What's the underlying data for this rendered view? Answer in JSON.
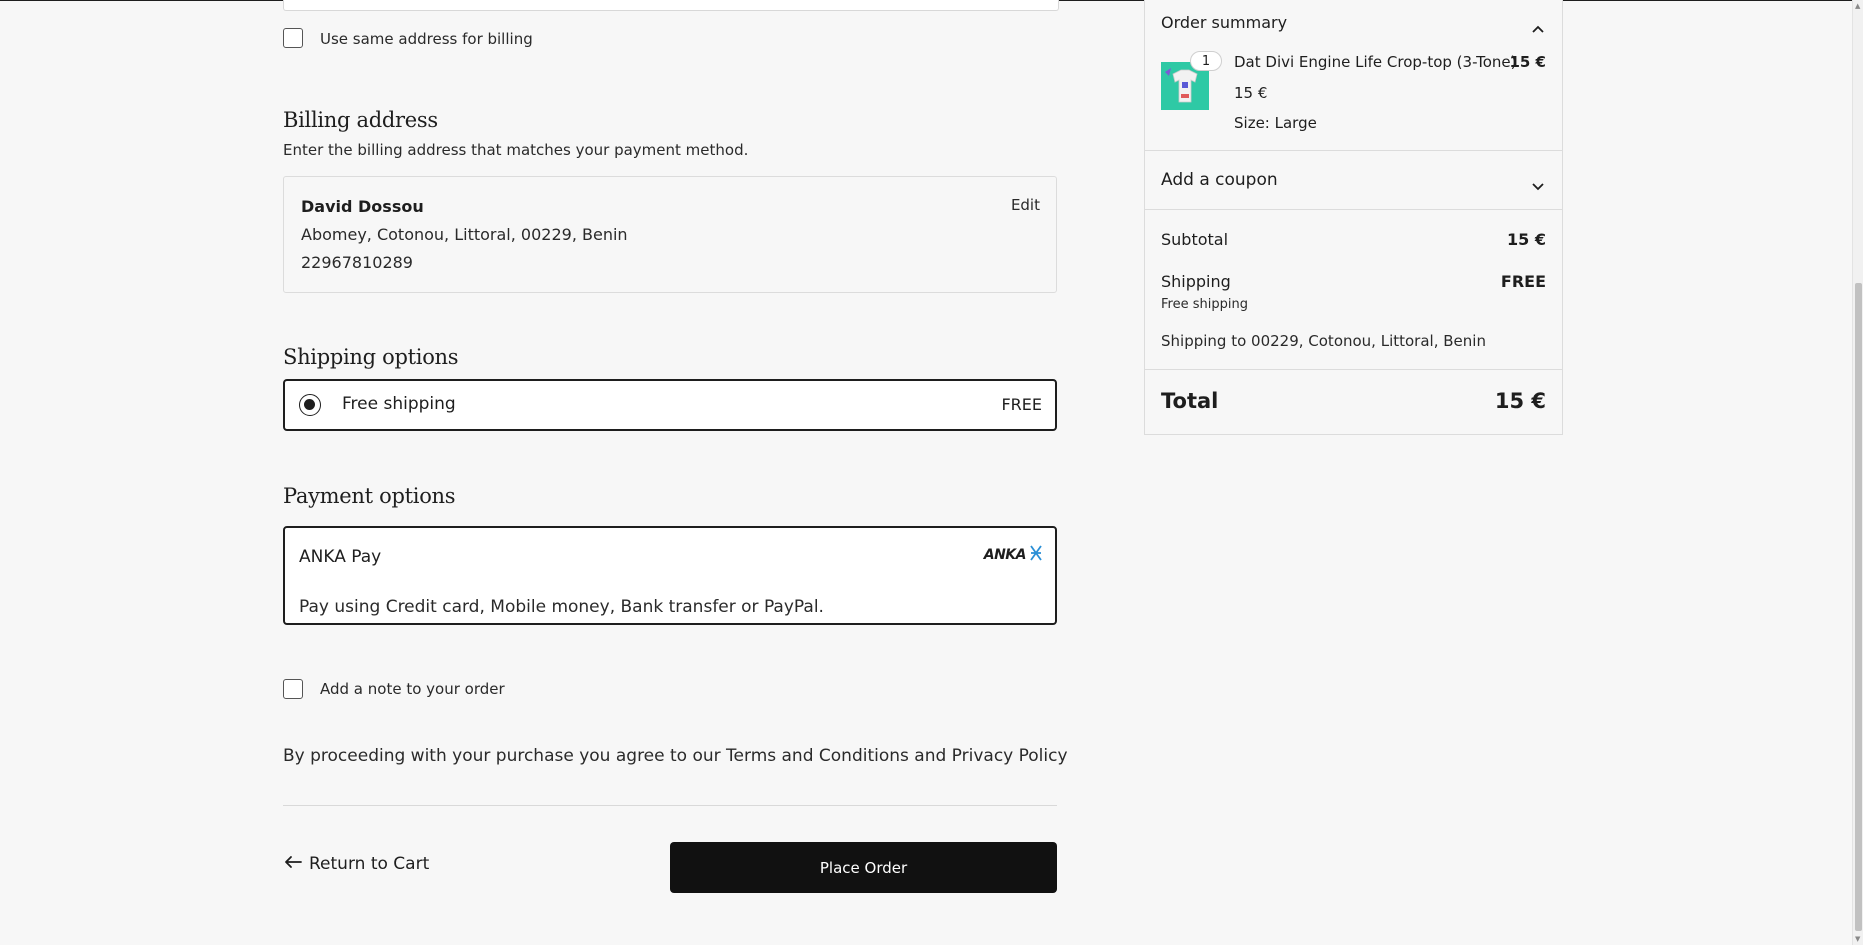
{
  "billing_same": {
    "label": "Use same address for billing",
    "checked": false
  },
  "billing": {
    "heading": "Billing address",
    "subtitle": "Enter the billing address that matches your payment method.",
    "name": "David Dossou",
    "address_line": "Abomey, Cotonou, Littoral, 00229, Benin",
    "phone": "22967810289",
    "edit_label": "Edit"
  },
  "shipping": {
    "heading": "Shipping options",
    "option_label": "Free shipping",
    "option_price": "FREE",
    "selected": true
  },
  "payment": {
    "heading": "Payment options",
    "method": "ANKA Pay",
    "logo_text": "ANKA",
    "logo_icon": "anka-symbol-icon",
    "description": "Pay using Credit card, Mobile money, Bank transfer or PayPal."
  },
  "note": {
    "label": "Add a note to your order",
    "checked": false
  },
  "terms": "By proceeding with your purchase you agree to our Terms and Conditions and Privacy Policy",
  "actions": {
    "return_label": "Return to Cart",
    "return_icon": "arrow-left-icon",
    "place_order_label": "Place Order"
  },
  "summary": {
    "title": "Order summary",
    "toggle_icon": "chevron-up-icon",
    "item": {
      "quantity": "1",
      "name": "Dat Divi Engine Life Crop-top (3-Tone)",
      "line_price": "15 €",
      "unit_price": "15 €",
      "size": "Size: Large",
      "thumbnail_bg": "#2ec9a5"
    },
    "coupon_label": "Add a coupon",
    "coupon_icon": "chevron-down-icon",
    "subtotal_label": "Subtotal",
    "subtotal_value": "15 €",
    "shipping_label": "Shipping",
    "shipping_value": "FREE",
    "shipping_method": "Free shipping",
    "shipping_destination": "Shipping to 00229, Cotonou, Littoral, Benin",
    "total_label": "Total",
    "total_value": "15 €"
  },
  "colors": {
    "background": "#f7f7f7",
    "primary": "#111111",
    "accent_logo": "#2a8fd6"
  }
}
